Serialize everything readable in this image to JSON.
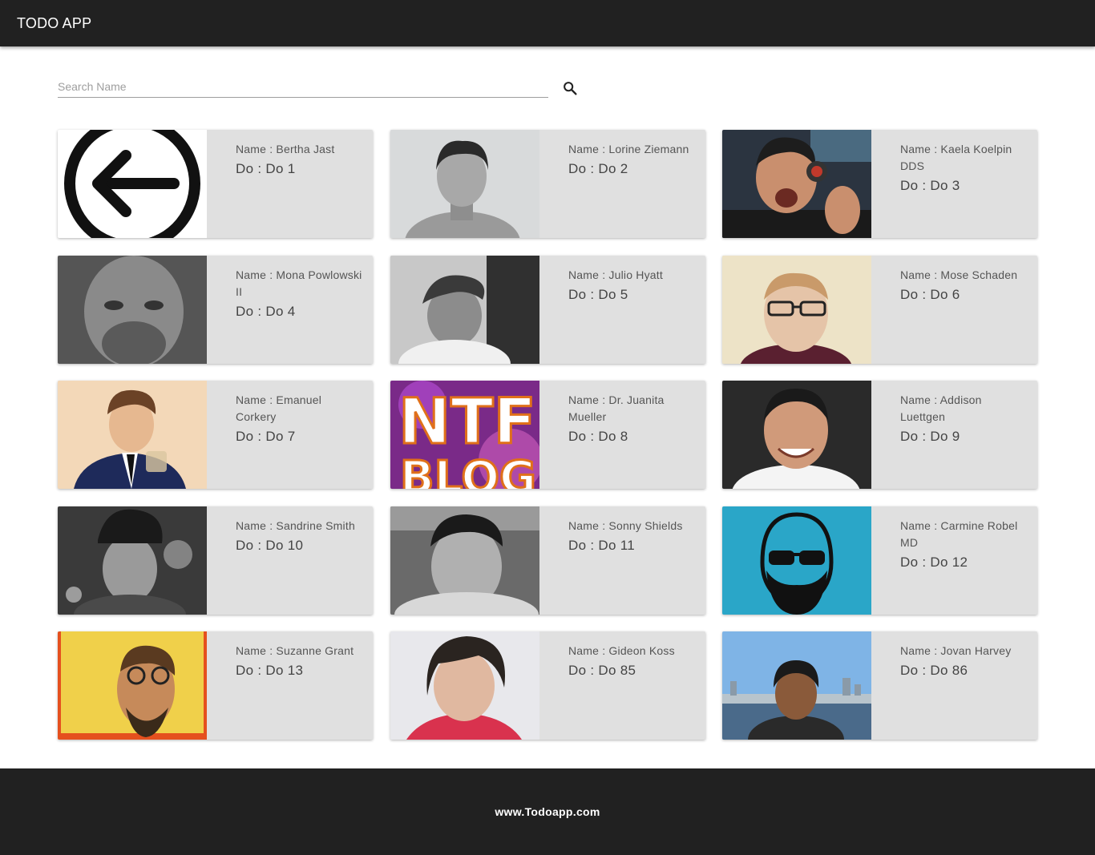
{
  "appbar": {
    "title": "TODO APP"
  },
  "search": {
    "placeholder": "Search Name",
    "value": "",
    "icon": "search-icon"
  },
  "cards": [
    {
      "name": "Name : Bertha Jast",
      "todo": "Do : Do 1",
      "avatar": "back-arrow-icon"
    },
    {
      "name": "Name : Lorine Ziemann",
      "todo": "Do : Do 2",
      "avatar": "photo"
    },
    {
      "name": "Name : Kaela Koelpin DDS",
      "todo": "Do : Do 3",
      "avatar": "photo"
    },
    {
      "name": "Name : Mona Powlowski II",
      "todo": "Do : Do 4",
      "avatar": "photo"
    },
    {
      "name": "Name : Julio Hyatt",
      "todo": "Do : Do 5",
      "avatar": "photo"
    },
    {
      "name": "Name : Mose Schaden",
      "todo": "Do : Do 6",
      "avatar": "photo"
    },
    {
      "name": "Name : Emanuel Corkery",
      "todo": "Do : Do 7",
      "avatar": "photo"
    },
    {
      "name": "Name : Dr. Juanita Mueller",
      "todo": "Do : Do 8",
      "avatar": "logo-image"
    },
    {
      "name": "Name : Addison Luettgen",
      "todo": "Do : Do 9",
      "avatar": "photo"
    },
    {
      "name": "Name : Sandrine Smith",
      "todo": "Do : Do 10",
      "avatar": "photo"
    },
    {
      "name": "Name : Sonny Shields",
      "todo": "Do : Do 11",
      "avatar": "photo"
    },
    {
      "name": "Name : Carmine Robel MD",
      "todo": "Do : Do 12",
      "avatar": "illustration"
    },
    {
      "name": "Name : Suzanne Grant",
      "todo": "Do : Do 13",
      "avatar": "photo"
    },
    {
      "name": "Name : Gideon Koss",
      "todo": "Do : Do 85",
      "avatar": "photo"
    },
    {
      "name": "Name : Jovan Harvey",
      "todo": "Do : Do 86",
      "avatar": "photo"
    }
  ],
  "footer": {
    "text": "www.Todoapp.com"
  }
}
